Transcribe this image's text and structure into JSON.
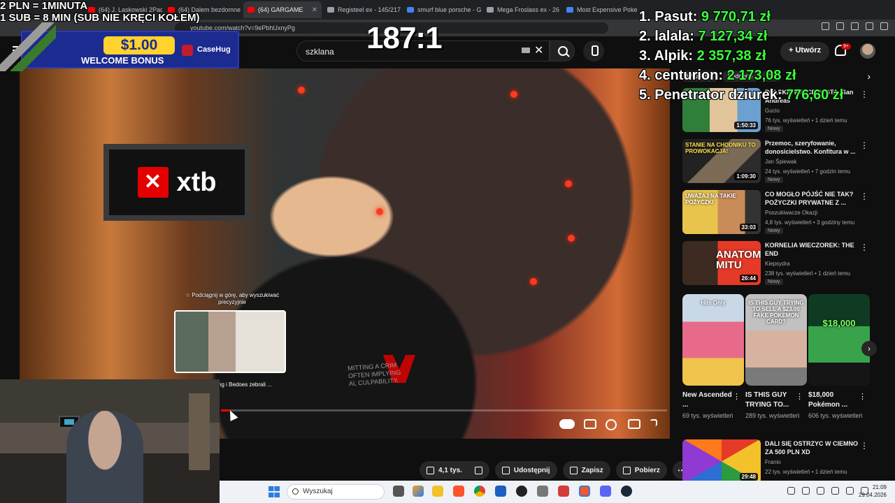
{
  "browser": {
    "tabs": [
      {
        "label": "(64) J. Laskowski 2Pac",
        "icon": "youtube-icon",
        "active": false
      },
      {
        "label": "(64) Dalem bezdomne",
        "icon": "youtube-icon",
        "active": false
      },
      {
        "label": "(64) GARGAME",
        "icon": "youtube-icon",
        "active": true
      },
      {
        "label": "Registeel ex - 145/217",
        "icon": "page-icon",
        "active": false
      },
      {
        "label": "smurf blue porsche - G",
        "icon": "google-icon",
        "active": false
      },
      {
        "label": "Mega Froslass ex - 26",
        "icon": "page-icon",
        "active": false
      },
      {
        "label": "Most Expensive Poke",
        "icon": "page-icon",
        "active": false
      }
    ],
    "url": "youtube.com/watch?v=9ePbhUxnyPg"
  },
  "youtube": {
    "search_query": "szklana",
    "create_label": "Utwórz",
    "notifications_badge": "9+"
  },
  "video": {
    "preview_hint": "Podciągnij w górę, aby wyszukiwać precyzyjnie",
    "preview_title": "ng i Bedoes zebrali ...",
    "progress_fraction": 0.02,
    "brand_text": "xtb",
    "shirt_text": [
      "MITTING A CRIM",
      "OFTEN IMPLYING",
      "AL CULPABILITY."
    ],
    "actions": {
      "likes": "4,1 tys.",
      "share": "Udostępnij",
      "save": "Zapisz",
      "download": "Pobierz"
    }
  },
  "sidebar": {
    "chips": [
      "Wszystko",
      "Podobne",
      "Dla"
    ],
    "recommendations": [
      {
        "title": "POLSKIE KIBICE W GTA: San Andreas",
        "channel": "Gucio",
        "meta": "76 tys. wyświetleń • 1 dzień temu",
        "badge": "Nowy",
        "duration": "1:50:33",
        "thumb_caption": ""
      },
      {
        "title": "Przemoc, szeryfowanie, donosicielstwo. Konfitura w ...",
        "channel": "Jan Śpiewak",
        "meta": "24 tys. wyświetleń • 7 godzin temu",
        "badge": "Nowy",
        "duration": "1:09:30",
        "thumb_caption": "STANIE NA CHODNIKU TO PROWOKACJA!"
      },
      {
        "title": "CO MOGŁO PÓJŚĆ NIE TAK? POŻYCZKI PRYWATNE Z ...",
        "channel": "Poszukiwacze Okazji",
        "meta": "4,8 tys. wyświetleń • 3 godziny temu",
        "badge": "Nowy",
        "duration": "33:03",
        "thumb_caption": "UWAŻAJ NA TAKIE POŻYCZKI"
      },
      {
        "title": "KORNELIA WIECZOREK: THE END",
        "channel": "Kiepsydra",
        "meta": "238 tys. wyświetleń • 1 dzień temu",
        "badge": "Nowy",
        "duration": "26:44",
        "thumb_caption": "ANATOMIA MITU"
      }
    ],
    "shorts": [
      {
        "title": "New Ascended ...",
        "views": "69 tys. wyświetleń",
        "caption": "Hits Only"
      },
      {
        "title": "IS THIS GUY TRYING TO...",
        "views": "289 tys. wyświetleń",
        "caption": "IS THIS GUY TRYING TO SELL A $23.00 FAKE POKEMON CARD?"
      },
      {
        "title": "$18,000 Pokémon ...",
        "views": "606 tys. wyświetleń",
        "caption": "$18,000"
      }
    ],
    "last": {
      "title": "DALI SIĘ OSTRZYC W CIEMNO ZA 500 PLN XD",
      "channel": "Franio",
      "meta": "22 tys. wyświetleń • 1 dzień temu",
      "duration": "29:48"
    }
  },
  "overlay": {
    "promo_lines": [
      "2 PLN = 1MINUTA",
      "1 SUB = 8 MIN (SUB NIE KRĘCI KOŁEM)"
    ],
    "bonus_amount": "$1.00",
    "bonus_text": "WELCOME BONUS",
    "brand": "CaseHug",
    "timer": "187:1",
    "leaderboard": [
      {
        "name": "1. Pasut: ",
        "amount": "9 770,71 zł"
      },
      {
        "name": "2. lalala: ",
        "amount": "7 127,34 zł"
      },
      {
        "name": "3. Alpik: ",
        "amount": "2 357,38 zł"
      },
      {
        "name": "4. centurion: ",
        "amount": "2 173,08 zł"
      },
      {
        "name": "5. Penetrator dziurek: ",
        "amount": "776,60 zł"
      }
    ]
  },
  "taskbar": {
    "search_placeholder": "Wyszukaj",
    "time": "21:09",
    "date": "29.04.2026"
  }
}
